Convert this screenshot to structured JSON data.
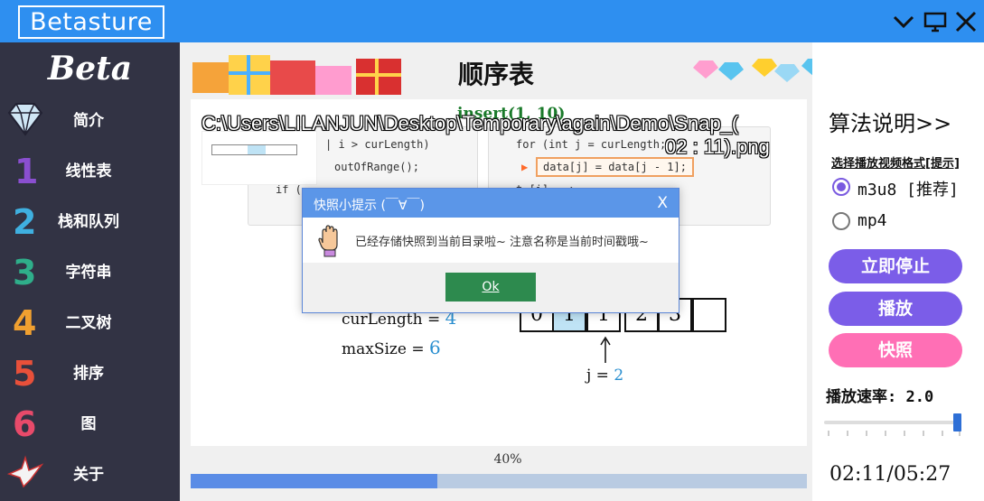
{
  "app": {
    "logo": "Betasture",
    "brand": "Beta"
  },
  "window": {
    "buttons": [
      "chevron-down-icon",
      "monitor-icon",
      "close-icon"
    ]
  },
  "sidebar": {
    "items": [
      {
        "label": "简介",
        "icon": "diamond-icon"
      },
      {
        "label": "线性表",
        "icon": "number-1-icon"
      },
      {
        "label": "栈和队列",
        "icon": "number-2-icon"
      },
      {
        "label": "字符串",
        "icon": "number-3-icon"
      },
      {
        "label": "二叉树",
        "icon": "number-4-icon"
      },
      {
        "label": "排序",
        "icon": "number-5-icon"
      },
      {
        "label": "图",
        "icon": "number-6-icon"
      },
      {
        "label": "关于",
        "icon": "origami-crane-icon"
      }
    ]
  },
  "main": {
    "title": "顺序表",
    "insert_title": "insert(1, 10)",
    "snapshot_path_line1": "C:\\Users\\LILANJUN\\Desktop\\Temporary\\again\\Demo\\Snap_(",
    "snapshot_path_line2": "02 : 11).png",
    "code_left": {
      "lines": [
        "| i > curLength)",
        "outOfRange();",
        "if ("
      ]
    },
    "code_right": {
      "lines": [
        "for (int j = curLength;",
        "data[j] = data[j - 1];",
        "  t [i] = ;"
      ]
    },
    "vars": {
      "curLength_label": "curLength =",
      "curLength_value": "4",
      "maxSize_label": "maxSize =",
      "maxSize_value": "6"
    },
    "cells": [
      "0",
      "1",
      "1",
      "2",
      "3",
      ""
    ],
    "pointer": {
      "label": "j =",
      "value": "2"
    },
    "progress": {
      "percent": 40,
      "label": "40%"
    }
  },
  "right": {
    "algo_title": "算法说明>>",
    "format_label": "选择播放视频格式[提示]",
    "formats": [
      {
        "label": "m3u8 [推荐]",
        "selected": true
      },
      {
        "label": "mp4",
        "selected": false
      }
    ],
    "buttons": {
      "stop": "立即停止",
      "play": "播放",
      "snapshot": "快照"
    },
    "speed_label": "播放速率: 2.0",
    "speed_fraction": 1.0,
    "time": "02:11/05:27",
    "colors": {
      "stop": "#7b5de8",
      "play": "#7b5de8",
      "snapshot": "#ff6fb5"
    }
  },
  "dialog": {
    "title": "快照小提示 (￣∀￣)",
    "close": "X",
    "message": "已经存储快照到当前目录啦~ 注意名称是当前时间戳哦~",
    "ok": "Ok",
    "icon": "hand-icon"
  }
}
